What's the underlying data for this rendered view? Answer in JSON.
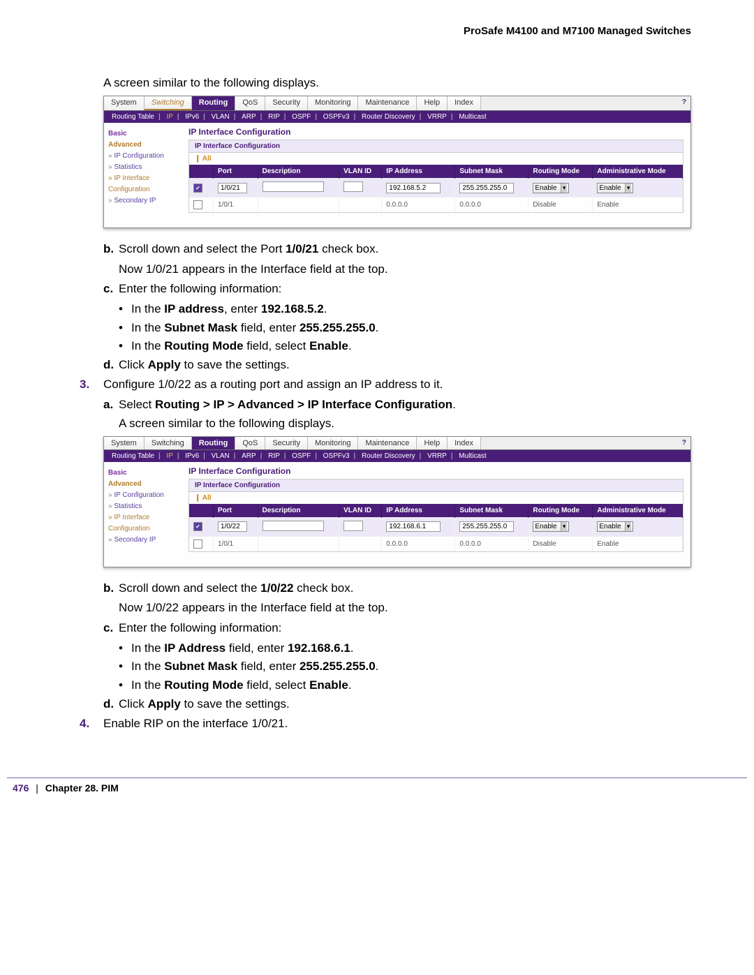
{
  "header": "ProSafe M4100 and M7100 Managed Switches",
  "intro1": "A screen similar to the following displays.",
  "intro2": "A screen similar to the following displays.",
  "tabs": [
    "System",
    "Switching",
    "Routing",
    "QoS",
    "Security",
    "Monitoring",
    "Maintenance",
    "Help",
    "Index"
  ],
  "subtabs": [
    "Routing Table",
    "IP",
    "IPv6",
    "VLAN",
    "ARP",
    "RIP",
    "OSPF",
    "OSPFv3",
    "Router Discovery",
    "VRRP",
    "Multicast"
  ],
  "sidebar": {
    "basic": "Basic",
    "advanced": "Advanced",
    "ipcfg": "IP Configuration",
    "stats": "Statistics",
    "ipint": "IP Interface Configuration",
    "secip": "Secondary IP"
  },
  "panel_title": "IP Interface Configuration",
  "panel_header": "IP Interface Configuration",
  "all_label": "All",
  "cols": {
    "port": "Port",
    "desc": "Description",
    "vlan": "VLAN ID",
    "ip": "IP Address",
    "mask": "Subnet Mask",
    "rmode": "Routing Mode",
    "amode": "Administrative Mode"
  },
  "ss1": {
    "r1": {
      "port": "1/0/21",
      "ip": "192.168.5.2",
      "mask": "255.255.255.0",
      "rmode": "Enable",
      "amode": "Enable"
    },
    "r2": {
      "port": "1/0/1",
      "ip": "0.0.0.0",
      "mask": "0.0.0.0",
      "rmode": "Disable",
      "amode": "Enable"
    }
  },
  "ss2": {
    "r1": {
      "port": "1/0/22",
      "ip": "192.168.6.1",
      "mask": "255.255.255.0",
      "rmode": "Enable",
      "amode": "Enable"
    },
    "r2": {
      "port": "1/0/1",
      "ip": "0.0.0.0",
      "mask": "0.0.0.0",
      "rmode": "Disable",
      "amode": "Enable"
    }
  },
  "text": {
    "b1a": "Scroll down and select the Port ",
    "b1b": "1/0/21",
    "b1c": " check box.",
    "b1follow": "Now 1/0/21 appears in the Interface field at the top.",
    "c1": "Enter the following information:",
    "c1i_a": "In the ",
    "c1i_b": "IP address",
    "c1i_c": ", enter ",
    "c1i_d": "192.168.5.2",
    "c1i_e": ".",
    "c1ii_a": "In the ",
    "c1ii_b": "Subnet Mask",
    "c1ii_c": " field, enter ",
    "c1ii_d": "255.255.255.0",
    "c1ii_e": ".",
    "c1iii_a": "In the ",
    "c1iii_b": "Routing Mode",
    "c1iii_c": " field, select ",
    "c1iii_d": "Enable",
    "c1iii_e": ".",
    "d1_a": "Click ",
    "d1_b": "Apply",
    "d1_c": " to save the settings.",
    "n3": "Configure 1/0/22 as a routing port and assign an IP address to it.",
    "a2_a": "Select ",
    "a2_b": "Routing > IP > Advanced > IP Interface Configuration",
    "a2_c": ".",
    "b2a": "Scroll down and select the ",
    "b2b": "1/0/22",
    "b2c": " check box.",
    "b2follow": "Now 1/0/22 appears in the Interface field at the top.",
    "c2": "Enter the following information:",
    "c2i_a": "In the ",
    "c2i_b": "IP Address",
    "c2i_c": " field, enter ",
    "c2i_d": "192.168.6.1",
    "c2i_e": ".",
    "c2ii_a": "In the ",
    "c2ii_b": "Subnet Mask",
    "c2ii_c": " field, enter ",
    "c2ii_d": "255.255.255.0",
    "c2ii_e": ".",
    "c2iii_a": "In the ",
    "c2iii_b": "Routing Mode",
    "c2iii_c": " field, select ",
    "c2iii_d": "Enable",
    "c2iii_e": ".",
    "d2_a": "Click ",
    "d2_b": "Apply",
    "d2_c": " to save the settings.",
    "n4": "Enable RIP on the interface 1/0/21."
  },
  "footer": {
    "page": "476",
    "sep": "|",
    "chapter": "Chapter 28.  PIM"
  }
}
